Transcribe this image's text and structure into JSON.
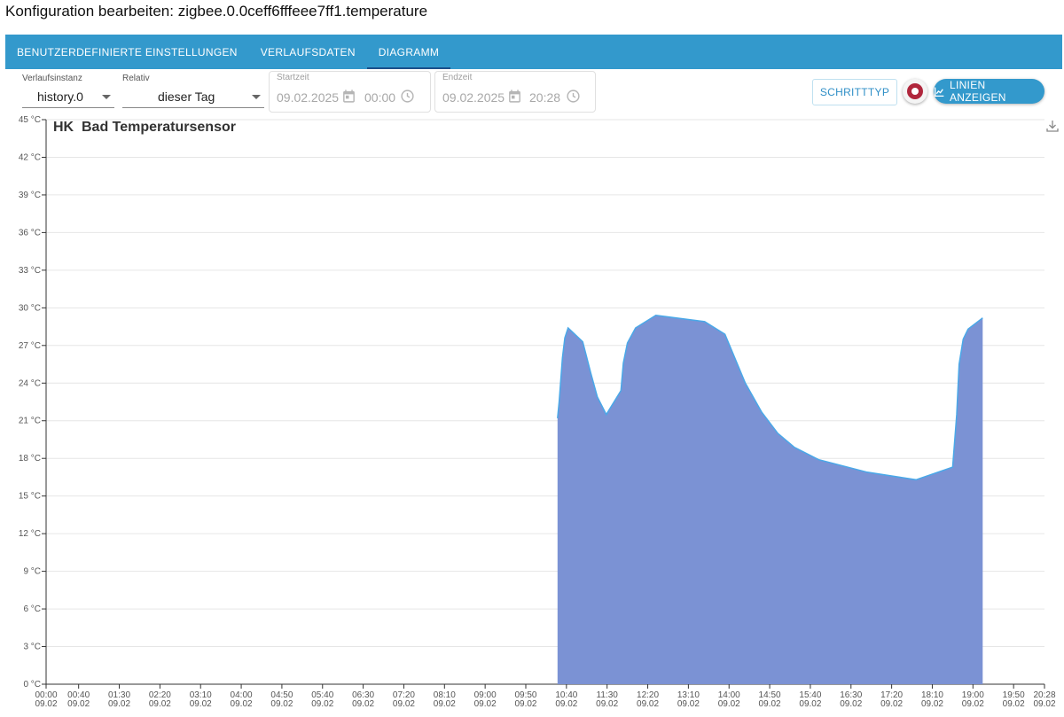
{
  "dialog": {
    "title": "Konfiguration bearbeiten: zigbee.0.0ceff6fffeee7ff1.temperature"
  },
  "tabs": [
    {
      "label": "BENUTZERDEFINIERTE EINSTELLUNGEN",
      "active": false
    },
    {
      "label": "VERLAUFSDATEN",
      "active": false
    },
    {
      "label": "DIAGRAMM",
      "active": true
    }
  ],
  "controls": {
    "instance": {
      "label": "Verlaufsinstanz",
      "value": "history.0"
    },
    "relative": {
      "label": "Relativ",
      "value": "dieser Tag"
    },
    "start": {
      "label": "Startzeit",
      "date": "09.02.2025",
      "time": "00:00"
    },
    "end": {
      "label": "Endzeit",
      "date": "09.02.2025",
      "time": "20:28"
    },
    "step_type_button": "SCHRITTTYP",
    "record_button_icon": "record-icon",
    "show_lines_button": "LINIEN ANZEIGEN",
    "show_lines_icon": "line-chart-icon",
    "download_icon": "download-icon"
  },
  "colors": {
    "accent": "#3399cc",
    "area_fill": "#7b92d4",
    "area_line": "#4aa8e8",
    "record": "#b0263c"
  },
  "chart_data": {
    "type": "area",
    "title": "HK  Bad Temperatursensor",
    "y_unit": "°C",
    "ylim": [
      0,
      45
    ],
    "y_ticks": [
      0,
      3,
      6,
      9,
      12,
      15,
      18,
      21,
      24,
      27,
      30,
      33,
      36,
      39,
      42,
      45
    ],
    "y_tick_labels": [
      "0 °C",
      "3 °C",
      "6 °C",
      "9 °C",
      "12 °C",
      "15 °C",
      "18 °C",
      "21 °C",
      "24 °C",
      "27 °C",
      "30 °C",
      "33 °C",
      "36 °C",
      "39 °C",
      "42 °C",
      "45 °C"
    ],
    "x_range_minutes": [
      0,
      1228
    ],
    "x_ticks": [
      {
        "t": 0,
        "time": "00:00",
        "date": "09.02"
      },
      {
        "t": 40,
        "time": "00:40",
        "date": "09.02"
      },
      {
        "t": 90,
        "time": "01:30",
        "date": "09.02"
      },
      {
        "t": 140,
        "time": "02:20",
        "date": "09.02"
      },
      {
        "t": 190,
        "time": "03:10",
        "date": "09.02"
      },
      {
        "t": 240,
        "time": "04:00",
        "date": "09.02"
      },
      {
        "t": 290,
        "time": "04:50",
        "date": "09.02"
      },
      {
        "t": 340,
        "time": "05:40",
        "date": "09.02"
      },
      {
        "t": 390,
        "time": "06:30",
        "date": "09.02"
      },
      {
        "t": 440,
        "time": "07:20",
        "date": "09.02"
      },
      {
        "t": 490,
        "time": "08:10",
        "date": "09.02"
      },
      {
        "t": 540,
        "time": "09:00",
        "date": "09.02"
      },
      {
        "t": 590,
        "time": "09:50",
        "date": "09.02"
      },
      {
        "t": 640,
        "time": "10:40",
        "date": "09.02"
      },
      {
        "t": 690,
        "time": "11:30",
        "date": "09.02"
      },
      {
        "t": 740,
        "time": "12:20",
        "date": "09.02"
      },
      {
        "t": 790,
        "time": "13:10",
        "date": "09.02"
      },
      {
        "t": 840,
        "time": "14:00",
        "date": "09.02"
      },
      {
        "t": 890,
        "time": "14:50",
        "date": "09.02"
      },
      {
        "t": 940,
        "time": "15:40",
        "date": "09.02"
      },
      {
        "t": 990,
        "time": "16:30",
        "date": "09.02"
      },
      {
        "t": 1040,
        "time": "17:20",
        "date": "09.02"
      },
      {
        "t": 1090,
        "time": "18:10",
        "date": "09.02"
      },
      {
        "t": 1140,
        "time": "19:00",
        "date": "09.02"
      },
      {
        "t": 1190,
        "time": "19:50",
        "date": "09.02"
      },
      {
        "t": 1228,
        "time": "20:28",
        "date": "09.02"
      }
    ],
    "series": [
      {
        "points": [
          {
            "x": "10:29",
            "y": 21.2
          },
          {
            "x": "10:31",
            "y": 22.5
          },
          {
            "x": "10:35",
            "y": 26.0
          },
          {
            "x": "10:38",
            "y": 27.6
          },
          {
            "x": "10:42",
            "y": 28.4
          },
          {
            "x": "11:00",
            "y": 27.3
          },
          {
            "x": "11:10",
            "y": 24.8
          },
          {
            "x": "11:18",
            "y": 22.9
          },
          {
            "x": "11:29",
            "y": 21.5
          },
          {
            "x": "11:47",
            "y": 23.4
          },
          {
            "x": "11:50",
            "y": 25.6
          },
          {
            "x": "11:55",
            "y": 27.2
          },
          {
            "x": "12:05",
            "y": 28.4
          },
          {
            "x": "12:30",
            "y": 29.4
          },
          {
            "x": "13:30",
            "y": 28.9
          },
          {
            "x": "13:55",
            "y": 27.9
          },
          {
            "x": "14:20",
            "y": 24.0
          },
          {
            "x": "14:40",
            "y": 21.7
          },
          {
            "x": "15:00",
            "y": 20.0
          },
          {
            "x": "15:20",
            "y": 18.9
          },
          {
            "x": "15:50",
            "y": 17.9
          },
          {
            "x": "16:50",
            "y": 16.9
          },
          {
            "x": "17:50",
            "y": 16.3
          },
          {
            "x": "18:35",
            "y": 17.3
          },
          {
            "x": "18:40",
            "y": 21.5
          },
          {
            "x": "18:43",
            "y": 25.5
          },
          {
            "x": "18:48",
            "y": 27.5
          },
          {
            "x": "18:54",
            "y": 28.3
          },
          {
            "x": "19:12",
            "y": 29.2
          }
        ]
      }
    ]
  }
}
